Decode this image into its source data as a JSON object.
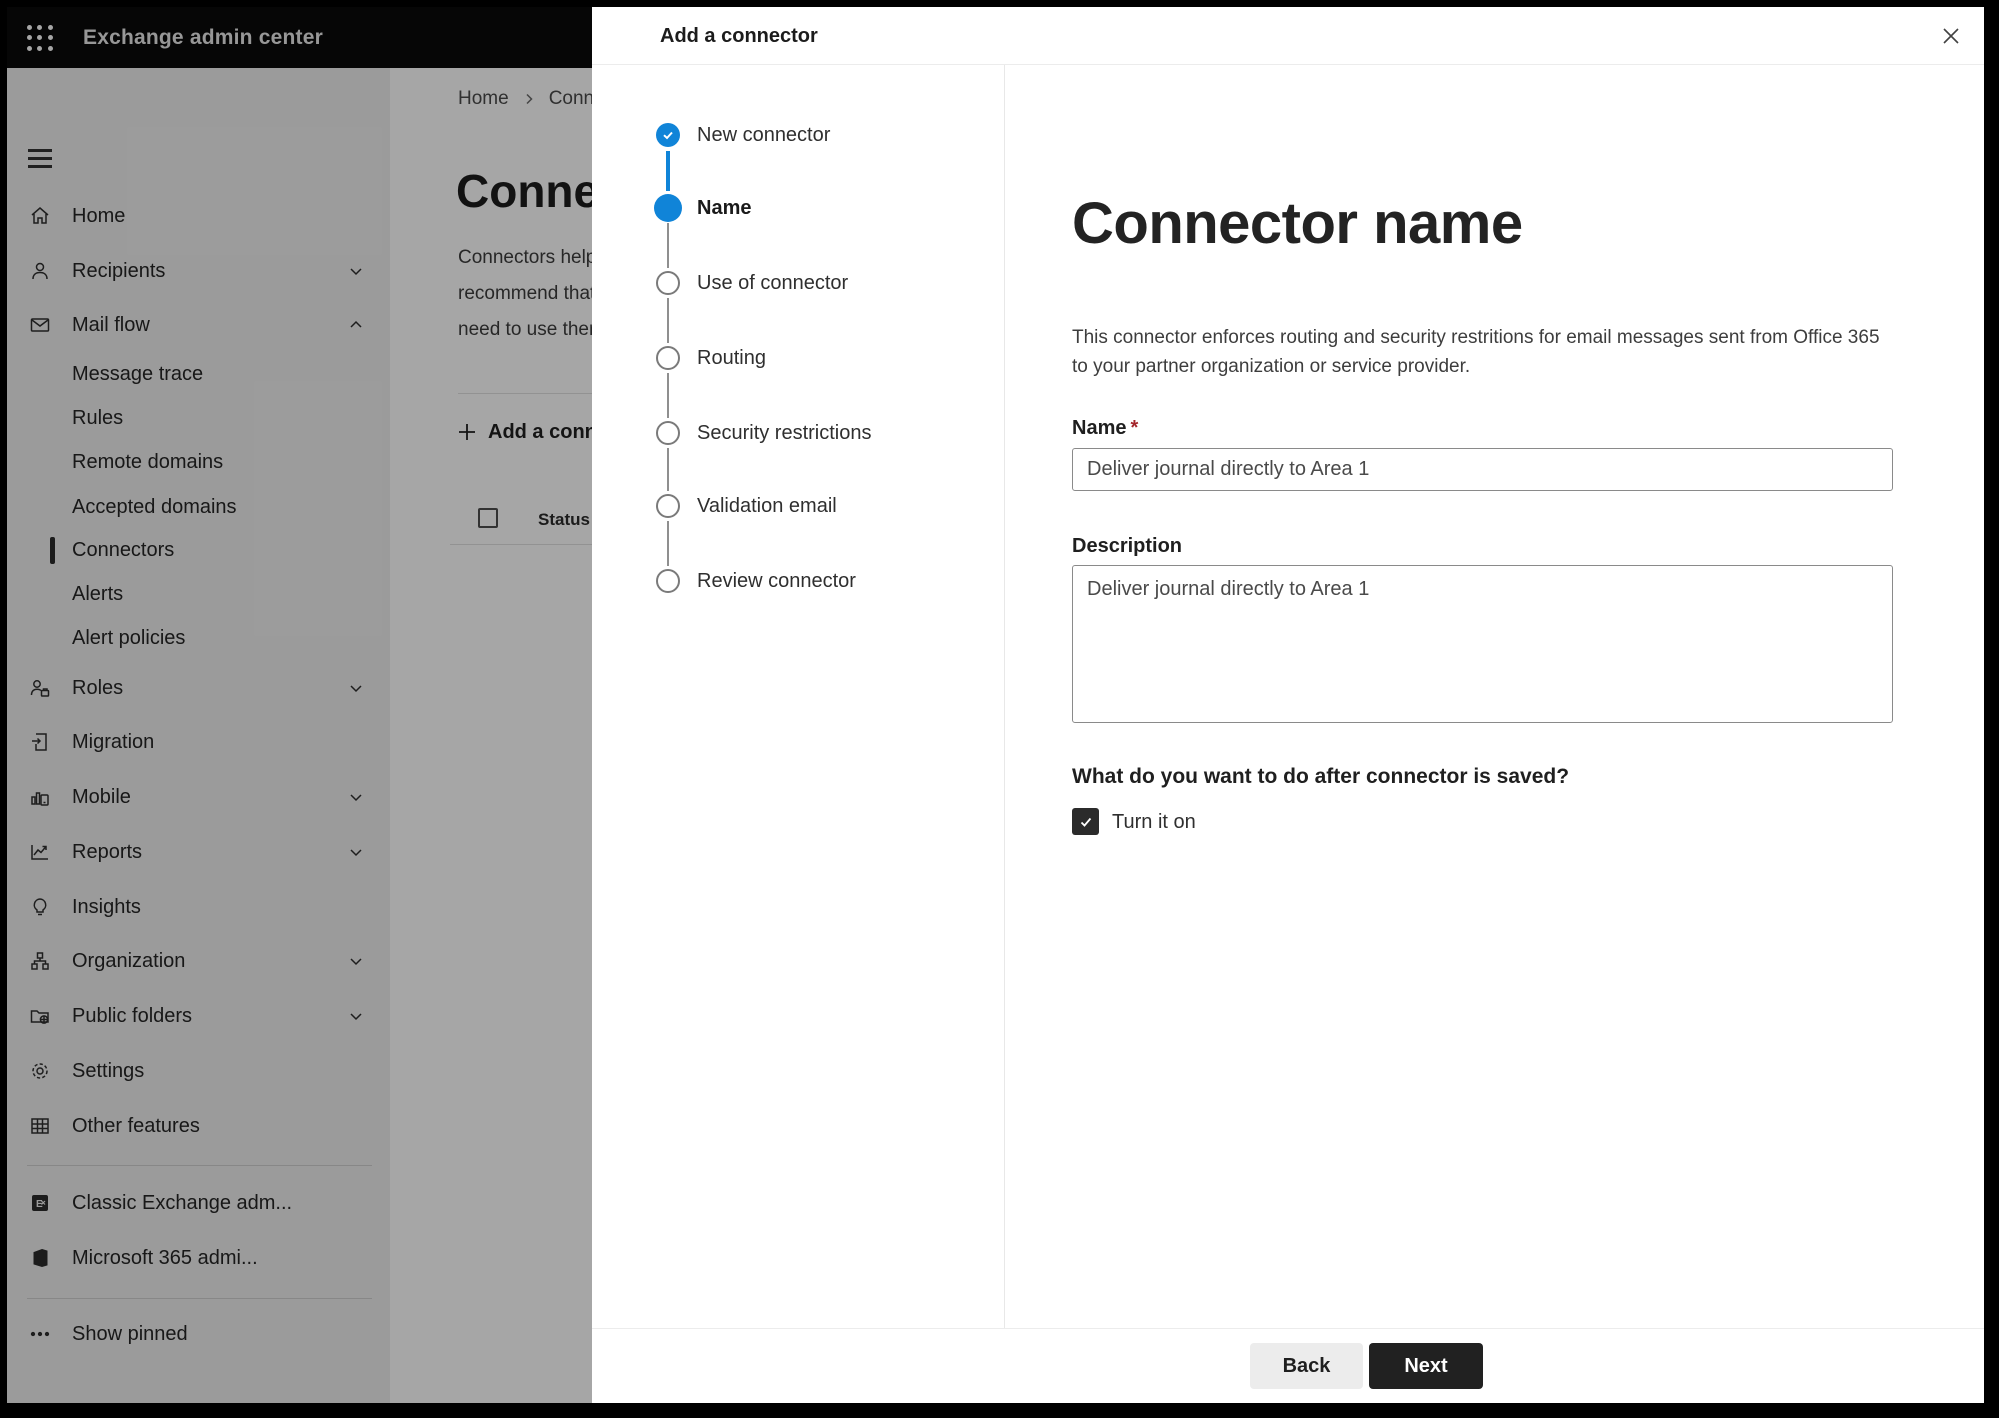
{
  "topbar": {
    "title": "Exchange admin center"
  },
  "sidebar": {
    "items": [
      {
        "label": "Home",
        "icon": "home-icon"
      },
      {
        "label": "Recipients",
        "icon": "person-icon",
        "chevron": "down"
      },
      {
        "label": "Mail flow",
        "icon": "mail-icon",
        "chevron": "up",
        "expanded": true
      },
      {
        "label": "Message trace",
        "sub": true
      },
      {
        "label": "Rules",
        "sub": true
      },
      {
        "label": "Remote domains",
        "sub": true
      },
      {
        "label": "Accepted domains",
        "sub": true
      },
      {
        "label": "Connectors",
        "sub": true,
        "selected": true
      },
      {
        "label": "Alerts",
        "sub": true
      },
      {
        "label": "Alert policies",
        "sub": true
      },
      {
        "label": "Roles",
        "icon": "roles-icon",
        "chevron": "down"
      },
      {
        "label": "Migration",
        "icon": "migration-icon"
      },
      {
        "label": "Mobile",
        "icon": "mobile-icon",
        "chevron": "down"
      },
      {
        "label": "Reports",
        "icon": "reports-icon",
        "chevron": "down"
      },
      {
        "label": "Insights",
        "icon": "lightbulb-icon"
      },
      {
        "label": "Organization",
        "icon": "org-icon",
        "chevron": "down"
      },
      {
        "label": "Public folders",
        "icon": "folder-globe-icon",
        "chevron": "down"
      },
      {
        "label": "Settings",
        "icon": "gear-icon"
      },
      {
        "label": "Other features",
        "icon": "grid-icon"
      },
      {
        "label": "Classic Exchange adm...",
        "icon": "exchange-logo-icon"
      },
      {
        "label": "Microsoft 365 admi...",
        "icon": "office-logo-icon"
      },
      {
        "label": "Show pinned",
        "icon": "ellipsis-icon"
      }
    ]
  },
  "page": {
    "breadcrumb": {
      "home": "Home",
      "current": "Conne"
    },
    "heading": "Connec",
    "body_lines": [
      "Connectors help",
      "recommend that",
      "need to use ther"
    ],
    "add_button": "Add a conn",
    "table": {
      "status_header": "Status"
    }
  },
  "modal": {
    "title": "Add a connector",
    "steps": [
      {
        "label": "New connector",
        "state": "completed"
      },
      {
        "label": "Name",
        "state": "active"
      },
      {
        "label": "Use of connector",
        "state": "upcoming"
      },
      {
        "label": "Routing",
        "state": "upcoming"
      },
      {
        "label": "Security restrictions",
        "state": "upcoming"
      },
      {
        "label": "Validation email",
        "state": "upcoming"
      },
      {
        "label": "Review connector",
        "state": "upcoming"
      }
    ],
    "content": {
      "heading": "Connector name",
      "description_lines": [
        "This connector enforces routing and security restritions for email messages sent from Office 365",
        "to your partner organization or service provider."
      ],
      "name_label": "Name",
      "required_marker": "*",
      "name_value": "Deliver journal directly to Area 1",
      "description_label": "Description",
      "description_value": "Deliver journal directly to Area 1",
      "question": "What do you want to do after connector is saved?",
      "turn_it_on_label": "Turn it on",
      "turn_it_on_checked": true
    },
    "footer": {
      "back": "Back",
      "next": "Next"
    }
  },
  "ui_colors": {
    "accent_blue": "#1084d8",
    "checkbox_dark": "#2b2b2b",
    "topbar_black": "#0a0a0a",
    "required_red": "#a4262c"
  }
}
